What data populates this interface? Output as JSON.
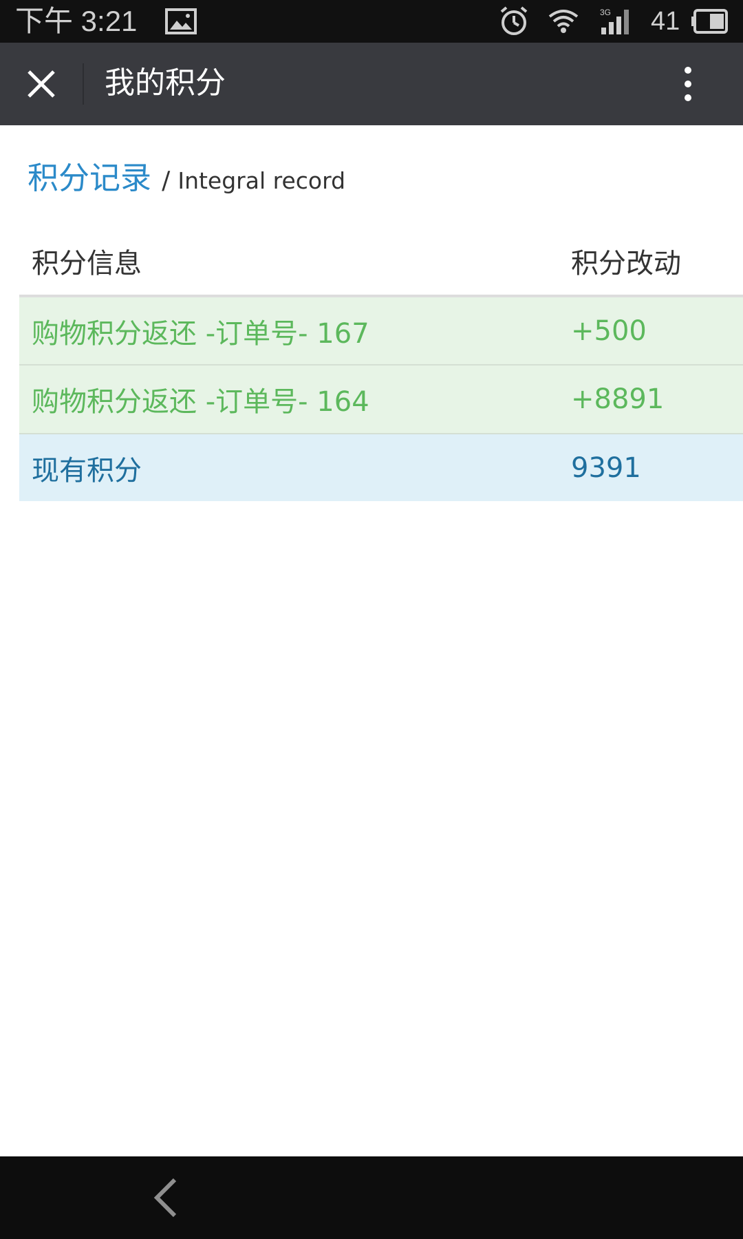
{
  "status_bar": {
    "time": "下午 3:21",
    "battery_level": "41",
    "network": "3G",
    "icons": [
      "image-icon",
      "alarm-icon",
      "wifi-icon",
      "signal-icon",
      "battery-icon"
    ]
  },
  "title_bar": {
    "title": "我的积分",
    "close_icon": "close-icon",
    "more_icon": "more-vertical-icon"
  },
  "section": {
    "title_cn": "积分记录",
    "separator": "/",
    "title_en": "Integral record"
  },
  "table": {
    "headers": [
      "积分信息",
      "积分改动"
    ],
    "rows": [
      {
        "info": "购物积分返还 -订单号- 167",
        "change": "+500"
      },
      {
        "info": "购物积分返还 -订单号- 164",
        "change": "+8891"
      }
    ],
    "total": {
      "label": "现有积分",
      "value": "9391"
    }
  },
  "colors": {
    "title_bar_bg": "#393a3f",
    "heading_accent": "#2b8ac9",
    "success_text": "#5cb85c",
    "success_bg": "#e7f4e6",
    "info_text": "#1f6f9e",
    "info_bg": "#dff0f8"
  },
  "nav_bar": {
    "back_icon": "back-chevron-icon"
  }
}
